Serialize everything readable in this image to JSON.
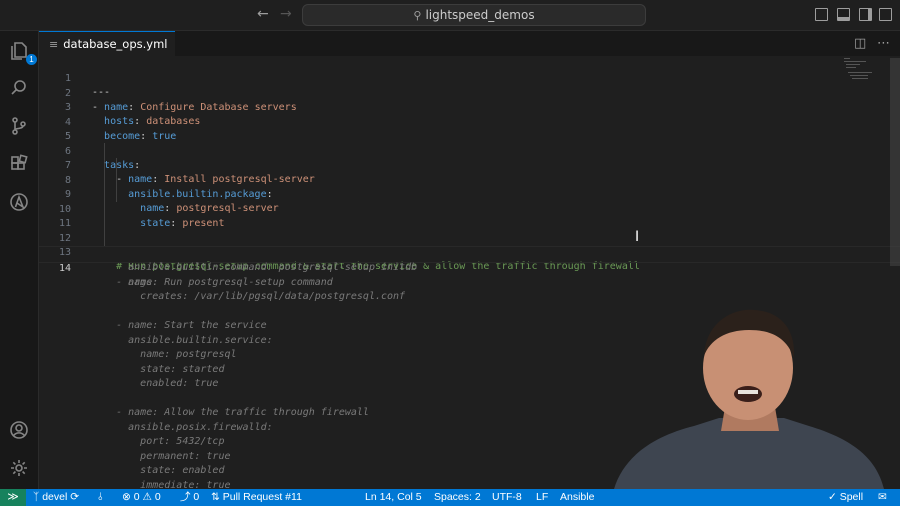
{
  "titlebar": {
    "search_text": "lightspeed_demos"
  },
  "activity": {
    "explorer_badge": "1"
  },
  "tab": {
    "filename": "database_ops.yml"
  },
  "editor": {
    "line_numbers": [
      "1",
      "2",
      "3",
      "4",
      "5",
      "6",
      "7",
      "8",
      "9",
      "10",
      "11",
      "12",
      "13",
      "14"
    ],
    "active_line": "14",
    "comment_line": "# Run postgresql-setup command & start the service & allow the traffic through firewall",
    "code": {
      "l1": "---",
      "l2_key": "name",
      "l2_val": "Configure Database servers",
      "l3_key": "hosts",
      "l3_val": "databases",
      "l4_key": "become",
      "l4_val": "true",
      "l6_key": "tasks",
      "l7_key": "name",
      "l7_val": "Install postgresql-server",
      "l8_key": "ansible.builtin.package",
      "l9_key": "name",
      "l9_val": "postgresql-server",
      "l10_key": "state",
      "l10_val": "present"
    },
    "suggestion_lines": [
      "- name: Run postgresql-setup command",
      "ansible.builtin.command: postgresql-setup initdb",
      "args:",
      "creates: /var/lib/pgsql/data/postgresql.conf",
      "",
      "- name: Start the service",
      "ansible.builtin.service:",
      "name: postgresql",
      "state: started",
      "enabled: true",
      "",
      "- name: Allow the traffic through firewall",
      "ansible.posix.firewalld:",
      "port: 5432/tcp",
      "permanent: true",
      "state: enabled",
      "immediate: true"
    ]
  },
  "statusbar": {
    "branch": "devel",
    "problems": "0 ⚠ 0",
    "ports": "0",
    "pull_request": "Pull Request #11",
    "position": "Ln 14, Col 5",
    "spaces": "Spaces: 2",
    "encoding": "UTF-8",
    "eol": "LF",
    "language": "Ansible",
    "spell": "Spell"
  },
  "colors": {
    "accent": "#0078d4",
    "remote": "#16825d",
    "comment": "#6a9955",
    "string": "#ce9178",
    "keyword": "#569cd6"
  }
}
